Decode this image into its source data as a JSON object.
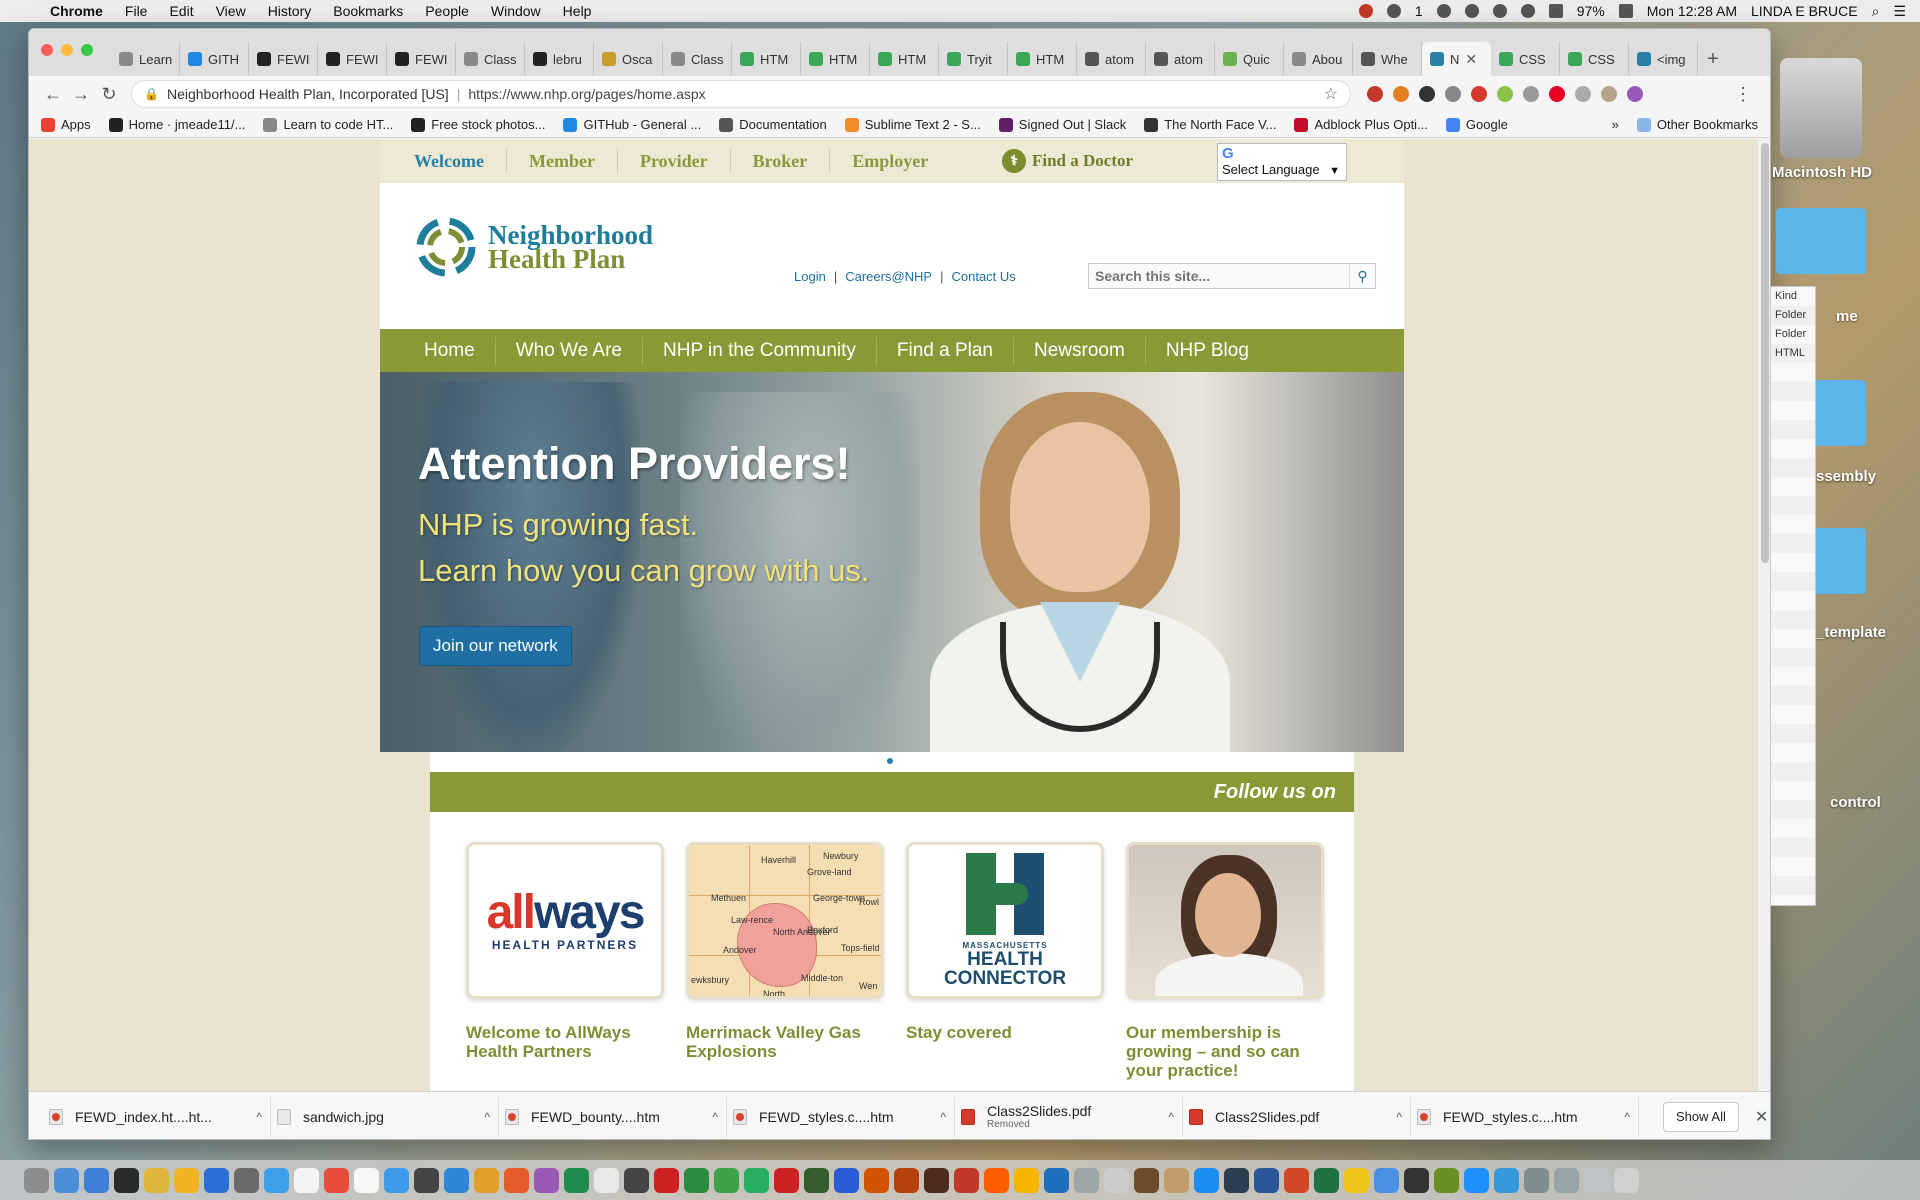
{
  "menubar": {
    "app": "Chrome",
    "items": [
      "File",
      "Edit",
      "View",
      "History",
      "Bookmarks",
      "People",
      "Window",
      "Help"
    ],
    "right": {
      "battery": "97%",
      "clock": "Mon 12:28 AM",
      "user": "LINDA E BRUCE",
      "notif_count": "1"
    }
  },
  "tabs": [
    {
      "label": "Learn",
      "color": "#888888"
    },
    {
      "label": "GITH",
      "color": "#1e88e5"
    },
    {
      "label": "FEWI",
      "color": "#222222"
    },
    {
      "label": "FEWI",
      "color": "#222222"
    },
    {
      "label": "FEWI",
      "color": "#222222"
    },
    {
      "label": "Class",
      "color": "#888888"
    },
    {
      "label": "lebru",
      "color": "#222222"
    },
    {
      "label": "Osca",
      "color": "#c89b2a"
    },
    {
      "label": "Class",
      "color": "#888888"
    },
    {
      "label": "HTM",
      "color": "#3aa757"
    },
    {
      "label": "HTM",
      "color": "#3aa757"
    },
    {
      "label": "HTM",
      "color": "#3aa757"
    },
    {
      "label": "Tryit",
      "color": "#3aa757"
    },
    {
      "label": "HTM",
      "color": "#3aa757"
    },
    {
      "label": "atom",
      "color": "#555555"
    },
    {
      "label": "atom",
      "color": "#555555"
    },
    {
      "label": "Quic",
      "color": "#6ab04c"
    },
    {
      "label": "Abou",
      "color": "#888888"
    },
    {
      "label": "Whe",
      "color": "#555555"
    },
    {
      "label": "N",
      "color": "#2a7fa8",
      "active": true
    },
    {
      "label": "CSS",
      "color": "#3aa757"
    },
    {
      "label": "CSS",
      "color": "#3aa757"
    },
    {
      "label": "<img",
      "color": "#2a7fa8"
    }
  ],
  "omnibox": {
    "cert": "Neighborhood Health Plan, Incorporated [US]",
    "url": "https://www.nhp.org/pages/home.aspx"
  },
  "bookmarks": [
    {
      "label": "Apps",
      "color": "#e94235"
    },
    {
      "label": "Home · jmeade11/...",
      "color": "#222222"
    },
    {
      "label": "Learn to code HT...",
      "color": "#888888"
    },
    {
      "label": "Free stock photos...",
      "color": "#222222"
    },
    {
      "label": "GITHub - General ...",
      "color": "#1e88e5"
    },
    {
      "label": "Documentation",
      "color": "#555555"
    },
    {
      "label": "Sublime Text 2 - S...",
      "color": "#f28c28"
    },
    {
      "label": "Signed Out | Slack",
      "color": "#611f69"
    },
    {
      "label": "The North Face V...",
      "color": "#333333"
    },
    {
      "label": "Adblock Plus Opti...",
      "color": "#c70d2c"
    },
    {
      "label": "Google",
      "color": "#4285f4"
    }
  ],
  "bookmarks_more": "»",
  "bookmarks_other": "Other Bookmarks",
  "site": {
    "topnav": [
      "Welcome",
      "Member",
      "Provider",
      "Broker",
      "Employer"
    ],
    "find_doctor": "Find a Doctor",
    "language": "Select Language",
    "logo_line1": "Neighborhood",
    "logo_line2": "Health Plan",
    "util_links": [
      "Login",
      "Careers@NHP",
      "Contact Us"
    ],
    "util_divider": "|",
    "search_placeholder": "Search this site...",
    "mainnav": [
      "Home",
      "Who We Are",
      "NHP in the Community",
      "Find a Plan",
      "Newsroom",
      "NHP Blog"
    ],
    "hero": {
      "title": "Attention Providers!",
      "sub1": "NHP is growing fast.",
      "sub2": "Learn how you can grow with us.",
      "button": "Join our network"
    },
    "follow": "Follow us on",
    "cards": [
      {
        "caption": "Welcome to AllWays Health Partners"
      },
      {
        "caption": "Merrimack Valley Gas Explosions"
      },
      {
        "caption": "Stay covered"
      },
      {
        "caption": "Our membership is growing – and so can your practice!"
      }
    ],
    "allways": {
      "part1": "all",
      "part2": "ways",
      "sub": "HEALTH PARTNERS"
    },
    "map_towns": [
      "Haverhill",
      "Grove-land",
      "Newbury",
      "Methuen",
      "Law-rence",
      "North Andover",
      "George-town",
      "Rowl",
      "Boxford",
      "Andover",
      "Tops-field",
      "ewksbury",
      "Middle-ton",
      "North",
      "Wen"
    ],
    "connector": {
      "ma": "MASSACHUSETTS",
      "hc1": "HEALTH",
      "hc2": "CONNECTOR"
    }
  },
  "downloads": [
    {
      "name": "FEWD_index.ht....ht...",
      "kind": "chrome"
    },
    {
      "name": "sandwich.jpg",
      "kind": "file"
    },
    {
      "name": "FEWD_bounty....htm",
      "kind": "chrome"
    },
    {
      "name": "FEWD_styles.c....htm",
      "kind": "chrome"
    },
    {
      "name": "Class2Slides.pdf",
      "sub": "Removed",
      "kind": "pdf"
    },
    {
      "name": "Class2Slides.pdf",
      "kind": "pdf"
    },
    {
      "name": "FEWD_styles.c....htm",
      "kind": "chrome"
    }
  ],
  "downloads_show_all": "Show All",
  "desktop": {
    "hd_label": "Macintosh HD",
    "labels": [
      "me",
      "ssembly",
      "_template",
      "control"
    ],
    "finder_rows": [
      "Kind",
      "Folder",
      "Folder",
      "HTML"
    ]
  },
  "dock_colors": [
    "#8d8d8d",
    "#4d8ed9",
    "#3f7fd6",
    "#2a2a2a",
    "#e0b53b",
    "#f0b323",
    "#2b6fd6",
    "#6a6a6a",
    "#3da0e8",
    "#f4f4f4",
    "#e74c3c",
    "#f7f7f7",
    "#3d9be9",
    "#444444",
    "#2d87d9",
    "#e0a028",
    "#e55c2a",
    "#9b59b6",
    "#1f8b4c",
    "#e8e8e8",
    "#444444",
    "#cc2222",
    "#2a8a3d",
    "#3fa24a",
    "#27ae60",
    "#cc2222",
    "#355c2d",
    "#2a5bd7",
    "#d35400",
    "#b7410e",
    "#4d2c1f",
    "#c0392b",
    "#ff5e00",
    "#f7b500",
    "#1f6fbf",
    "#9aa7a6",
    "#cccccc",
    "#6e4b2a",
    "#c19a6b",
    "#1b8df0",
    "#2c3e50",
    "#2b579a",
    "#d24726",
    "#207245",
    "#f0c419",
    "#4a90e2",
    "#333333",
    "#6b8e23",
    "#1e90ff",
    "#3498db",
    "#7f8c8d",
    "#95a5a6",
    "#bdc3c7",
    "#d0d0d0"
  ]
}
